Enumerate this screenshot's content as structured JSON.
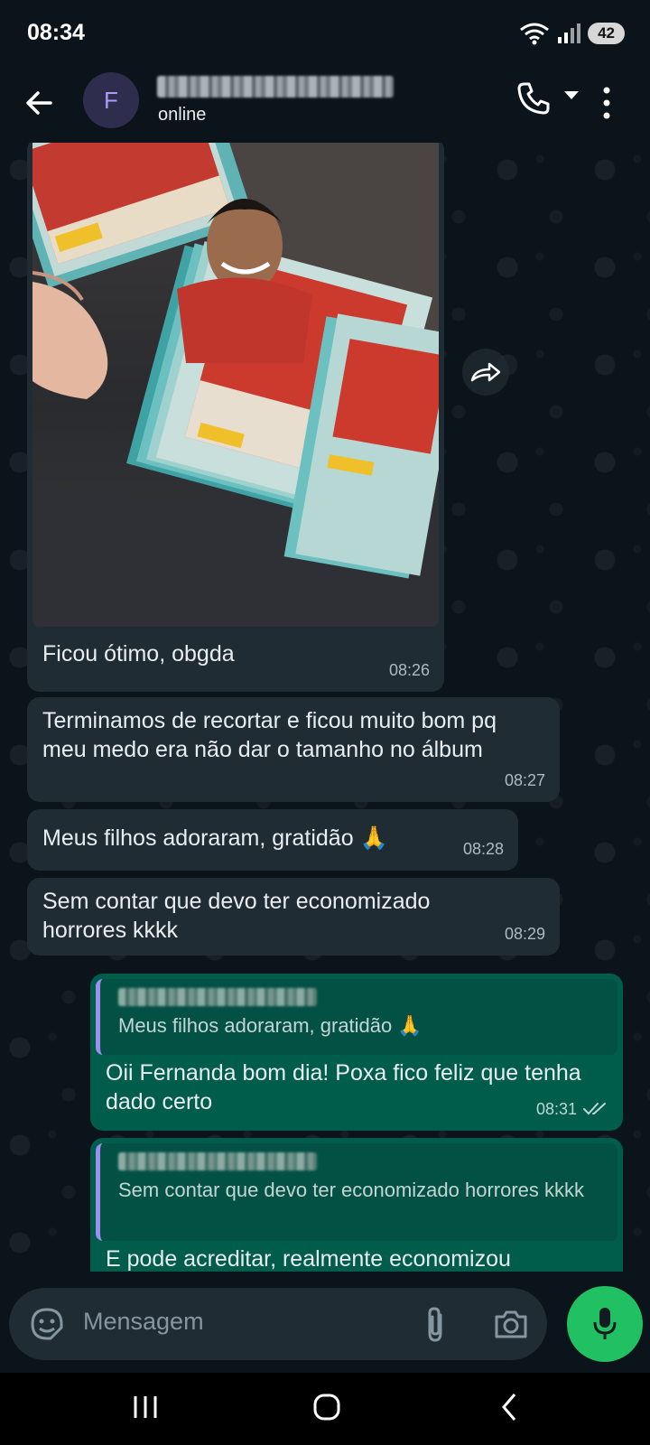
{
  "status_bar": {
    "time": "08:34",
    "battery": "42"
  },
  "header": {
    "avatar_letter": "F",
    "status": "online"
  },
  "messages": [
    {
      "text": "Ficou ótimo, obgda",
      "time": "08:26"
    },
    {
      "text": "Terminamos de recortar e ficou muito bom pq meu medo era não dar o tamanho no álbum",
      "time": "08:27"
    },
    {
      "text": "Meus filhos adoraram, gratidão 🙏",
      "time": "08:28"
    },
    {
      "text": "Sem contar que devo ter economizado horrores kkkk",
      "time": "08:29"
    },
    {
      "quote": "Meus filhos adoraram, gratidão 🙏",
      "text": "Oii Fernanda bom dia! Poxa fico feliz que tenha dado certo",
      "time": "08:31"
    },
    {
      "quote": "Sem contar que devo ter economizado horrores kkkk",
      "text": "E pode acreditar, realmente economizou"
    }
  ],
  "input": {
    "placeholder": "Mensagem"
  },
  "icons": [
    "back-arrow-icon",
    "phone-icon",
    "chevron-down-icon",
    "more-vert-icon",
    "forward-icon",
    "sticker-icon",
    "attach-icon",
    "camera-icon",
    "mic-icon",
    "read-receipt-icon",
    "wifi-icon",
    "signal-icon",
    "recents-icon",
    "home-icon",
    "nav-back-icon"
  ],
  "colors": {
    "incoming": "#202c33",
    "outgoing": "#005c4b",
    "accent": "#21c063"
  }
}
